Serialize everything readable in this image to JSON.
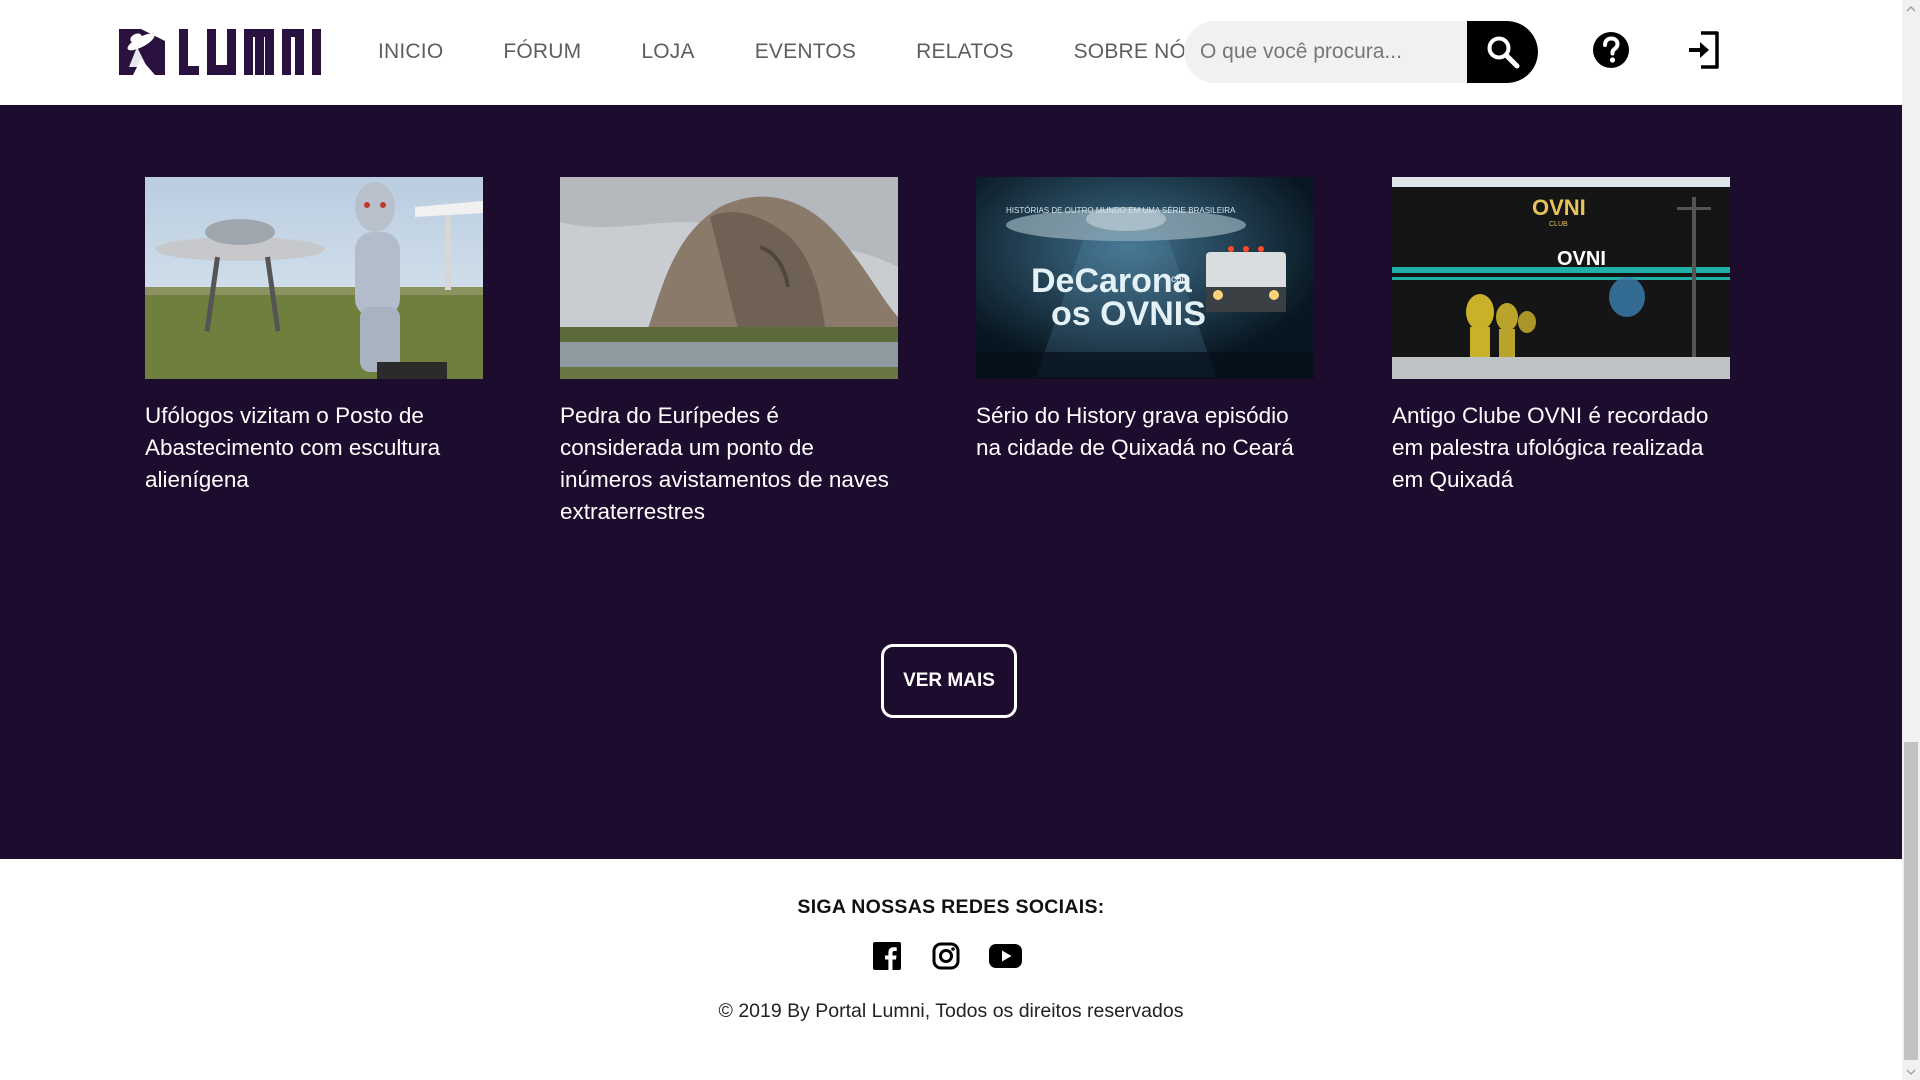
{
  "header": {
    "logo_text": "LUMNI",
    "nav": [
      "INICIO",
      "FÓRUM",
      "LOJA",
      "EVENTOS",
      "RELATOS",
      "SOBRE NÓS"
    ],
    "search_placeholder": "O que você procura...",
    "help_icon": "help-circle-icon",
    "login_icon": "sign-in-icon"
  },
  "articles": [
    {
      "title": "Ufólogos vizitam o Posto de Abastecimento com escultura alienígena"
    },
    {
      "title": "Pedra do Eurípedes é considerada um ponto de inúmeros avistamentos de naves extraterrestres"
    },
    {
      "title": "Sério do History grava episódio na cidade de Quixadá no Ceará",
      "image_caption": "HISTÓRIAS DE OUTRO MUNDO EM UMA SÉRIE BRASILEIRA",
      "image_title_1": "DeCarona",
      "image_title_small": "com",
      "image_title_2": "os OVNIS"
    },
    {
      "title": "Antigo Clube OVNI é recordado em palestra ufológica realizada em Quixadá",
      "image_sign": "OVNI",
      "image_sign_sub": "CLUB",
      "image_wall": "OVNI"
    }
  ],
  "more_button": "VER MAIS",
  "footer": {
    "follow": "SIGA NOSSAS REDES SOCIAIS:",
    "social": [
      "facebook-icon",
      "instagram-icon",
      "youtube-icon"
    ],
    "copyright": "© 2019 By Portal Lumni, Todos os direitos reservados"
  },
  "colors": {
    "main_bg": "#1e0c2f",
    "brand_purple": "#2a1240",
    "header_bg": "#ffffff",
    "search_button": "#000000",
    "text_on_dark": "#ffffff"
  }
}
